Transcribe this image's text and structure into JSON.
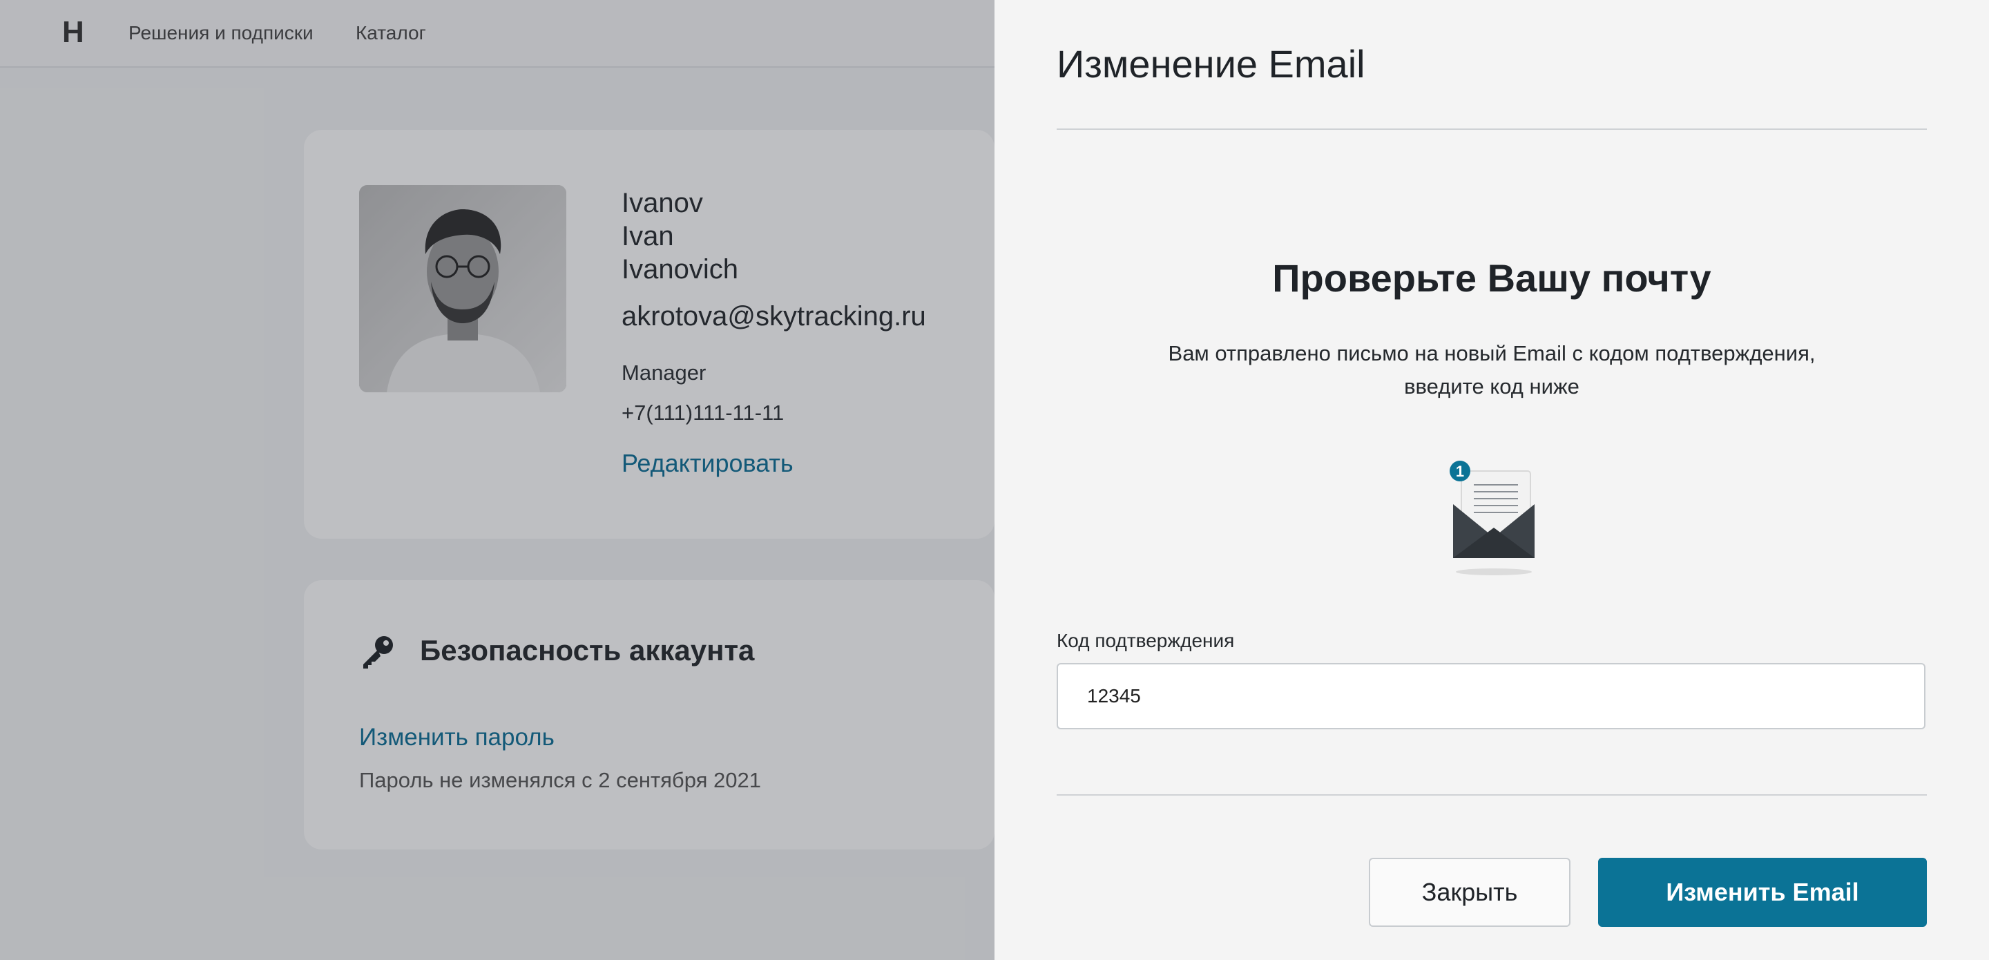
{
  "header": {
    "logo": "H",
    "nav": [
      "Решения и подписки",
      "Каталог"
    ]
  },
  "profile": {
    "last_name": "Ivanov",
    "first_name": "Ivan",
    "middle_name": "Ivanovich",
    "email": "akrotova@skytracking.ru",
    "role": "Manager",
    "phone": "+7(111)111-11-11",
    "edit_link": "Редактировать"
  },
  "security": {
    "title": "Безопасность аккаунта",
    "change_password_link": "Изменить пароль",
    "password_note": "Пароль не изменялся с 2 сентября 2021"
  },
  "modal": {
    "title": "Изменение Email",
    "check_title": "Проверьте Вашу почту",
    "check_text_line1": "Вам отправлено письмо на новый Email с кодом подтверждения,",
    "check_text_line2": "введите код ниже",
    "envelope_badge": "1",
    "code_label": "Код подтверждения",
    "code_value": "12345",
    "close_button": "Закрыть",
    "submit_button": "Изменить Email"
  },
  "colors": {
    "accent": "#0b7396",
    "link": "#0b6e96",
    "overlay": "rgba(40,44,52,0.30)"
  }
}
